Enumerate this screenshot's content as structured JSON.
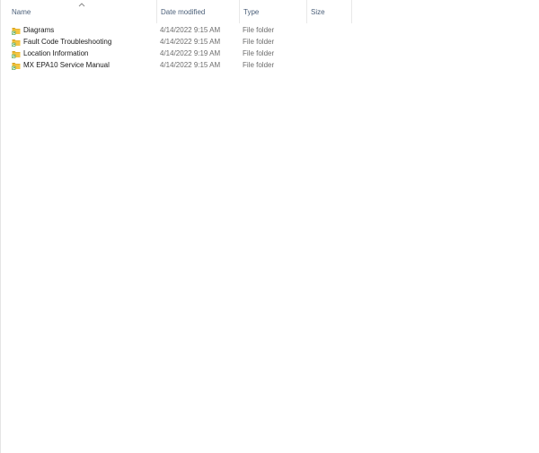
{
  "columns": {
    "name": "Name",
    "date": "Date modified",
    "type": "Type",
    "size": "Size"
  },
  "sort": {
    "column": "name",
    "direction": "ascending",
    "icon": "chevron-up-icon"
  },
  "files": [
    {
      "name": "Diagrams",
      "date": "4/14/2022 9:15 AM",
      "type": "File folder",
      "icon": "folder-icon"
    },
    {
      "name": "Fault Code Troubleshooting",
      "date": "4/14/2022 9:15 AM",
      "type": "File folder",
      "icon": "folder-icon"
    },
    {
      "name": "Location Information",
      "date": "4/14/2022 9:19 AM",
      "type": "File folder",
      "icon": "folder-icon"
    },
    {
      "name": "MX EPA10 Service Manual",
      "date": "4/14/2022 9:15 AM",
      "type": "File folder",
      "icon": "folder-icon"
    }
  ],
  "colors": {
    "folder_yellow": "#f4c542",
    "folder_dark": "#d9a41e",
    "shortcut_green": "#3a9a3a",
    "header_text": "#4c607a"
  }
}
